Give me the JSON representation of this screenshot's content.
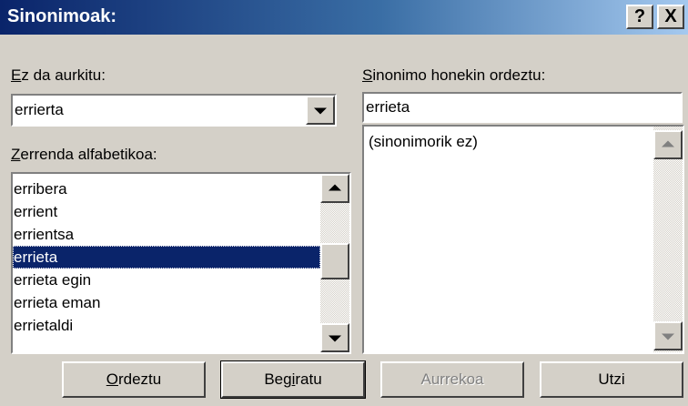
{
  "window": {
    "title": "Sinonimoak:",
    "help_button": "?",
    "close_button": "X"
  },
  "not_found": {
    "label_accel": "E",
    "label_rest": "z da aurkitu:",
    "value": "errierta"
  },
  "replace": {
    "label_accel": "S",
    "label_rest": "inonimo honekin ordeztu:",
    "value": "errieta"
  },
  "alphabetical": {
    "label_accel": "Z",
    "label_rest": "errenda alfabetikoa:",
    "items": [
      "erribera",
      "errient",
      "errientsa",
      "errieta",
      "errieta egin",
      "errieta eman",
      "errietaldi"
    ],
    "selected": "errieta"
  },
  "synonyms": {
    "items": [
      "(sinonimorik ez)"
    ]
  },
  "buttons": {
    "replace_accel": "O",
    "replace_rest": "rdeztu",
    "lookup_pre": "Beg",
    "lookup_accel": "i",
    "lookup_post": "ratu",
    "previous": "Aurrekoa",
    "cancel": "Utzi"
  },
  "colors": {
    "title_gradient_start": "#0a246a",
    "title_gradient_end": "#a6caf0",
    "selection": "#0a246a",
    "face": "#d4d0c8"
  }
}
